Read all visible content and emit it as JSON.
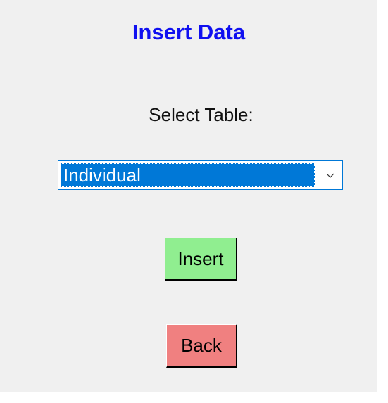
{
  "window": {
    "title": "Insert Data",
    "accent_color": "#1010f0"
  },
  "form": {
    "table_label": "Select Table:",
    "table_select": {
      "value": "Individual"
    }
  },
  "buttons": {
    "insert_label": "Insert",
    "insert_color": "#90ee90",
    "back_label": "Back",
    "back_color": "#f08080"
  }
}
